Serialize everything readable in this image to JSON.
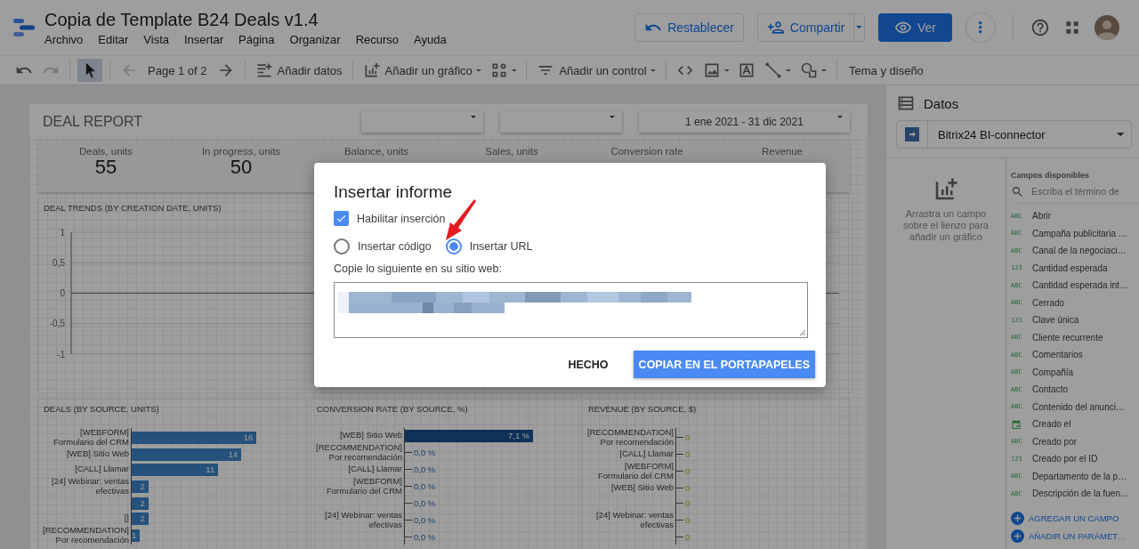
{
  "app": {
    "title": "Copia de Template B24 Deals v1.4",
    "menu": [
      "Archivo",
      "Editar",
      "Vista",
      "Insertar",
      "Página",
      "Organizar",
      "Recurso",
      "Ayuda"
    ],
    "actions": [
      {
        "kind": "reset",
        "label": "Restablecer"
      },
      {
        "kind": "share",
        "label": "Compartir"
      },
      {
        "kind": "view",
        "label": "Ver"
      }
    ]
  },
  "toolbar": [
    {
      "kind": "undo",
      "disabled": false,
      "selected": false
    },
    {
      "kind": "redo",
      "disabled": true,
      "selected": false
    },
    {
      "kind": "select",
      "disabled": false,
      "selected": true,
      "divider_before": true
    },
    {
      "kind": "prev",
      "disabled": true,
      "selected": false,
      "divider_before": true
    },
    {
      "kind": "page",
      "label": "Page 1 of 2",
      "disabled": false,
      "selected": false
    },
    {
      "kind": "next",
      "disabled": false,
      "selected": false
    },
    {
      "kind": "data",
      "label": "Añadir datos",
      "disabled": false,
      "selected": false,
      "divider_before": true
    },
    {
      "kind": "chart",
      "label": "Añadir un gráfico",
      "caret": true,
      "disabled": false,
      "selected": false,
      "divider_before": true
    },
    {
      "kind": "component",
      "caret": true,
      "disabled": false,
      "selected": false
    },
    {
      "kind": "control",
      "label": "Añadir un control",
      "caret": true,
      "disabled": false,
      "selected": false,
      "divider_before": true
    },
    {
      "kind": "embed",
      "disabled": false,
      "selected": false,
      "divider_before": true
    },
    {
      "kind": "image",
      "caret": true,
      "disabled": false,
      "selected": false
    },
    {
      "kind": "textbox",
      "disabled": false,
      "selected": false
    },
    {
      "kind": "line",
      "caret": true,
      "disabled": false,
      "selected": false
    },
    {
      "kind": "shape",
      "caret": true,
      "disabled": false,
      "selected": false
    },
    {
      "kind": "theme",
      "label": "Tema y diseño",
      "disabled": false,
      "selected": false,
      "divider_before": true
    }
  ],
  "report": {
    "title": "DEAL REPORT",
    "filters": [
      {
        "kind": "empty"
      },
      {
        "kind": "empty"
      },
      {
        "kind": "date",
        "value": "1 ene 2021 - 31 dic 2021"
      }
    ],
    "kpis": [
      {
        "label": "Deals, units",
        "value": "55"
      },
      {
        "label": "In progress, units",
        "value": "50"
      },
      {
        "label": "Balance, units"
      },
      {
        "label": "Sales, units"
      },
      {
        "label": "Conversion rate"
      },
      {
        "label": "Revenue"
      }
    ],
    "trend": {
      "title": "DEAL TRENDS (BY CREATION DATE, UNITS)",
      "axis_labels": [
        "1",
        "0,5",
        "0",
        "-0,5",
        "-1"
      ]
    },
    "charts": [
      {
        "title": "DEALS (BY SOURCE, UNITS)",
        "rows": [
          {
            "label": "[WEBFORM] Formulario del CRM",
            "level": 0.75,
            "reading": "16"
          },
          {
            "label": "[WEB] Sitio Web",
            "level": 0.66,
            "reading": "14"
          },
          {
            "label": "[CALL] Llamar",
            "level": 0.52,
            "reading": "11"
          },
          {
            "label": "[24] Webinar: ventas efectivas",
            "level": 0.1,
            "reading": "2"
          },
          {
            "level": 0.1,
            "reading": "2"
          },
          {
            "label": "[]",
            "level": 0.1,
            "reading": "2"
          },
          {
            "label": "[RECOMMENDATION] Por recomendación",
            "level": 0.05,
            "reading": "1"
          }
        ]
      },
      {
        "title": "CONVERSION RATE (BY SOURCE, %)",
        "rows": [
          {
            "label": "[WEB] Sitio Web",
            "level": 0.78,
            "reading": "7,1 %"
          },
          {
            "label": "[RECOMMENDATION] Por recomendación",
            "level": 0,
            "reading": "0,0 %"
          },
          {
            "label": "[CALL] Llamar",
            "level": 0,
            "reading": "0,0 %"
          },
          {
            "label": "[WEBFORM] Formulario del CRM",
            "level": 0,
            "reading": "0,0 %"
          },
          {
            "level": 0,
            "reading": "0,0 %"
          },
          {
            "label": "[24] Webinar: ventas efectivas",
            "level": 0,
            "reading": "0,0 %"
          },
          {
            "level": 0,
            "reading": "0,0 %"
          }
        ]
      },
      {
        "title": "REVENUE (BY SOURCE, $)",
        "rows": [
          {
            "label": "[RECOMMENDATION] Por recomendación",
            "level": 0,
            "reading": "0"
          },
          {
            "label": "[CALL] Llamar",
            "level": 0,
            "reading": "0"
          },
          {
            "label": "[WEBFORM] Formulario del CRM",
            "level": 0,
            "reading": "0"
          },
          {
            "label": "[WEB] Sitio Web",
            "level": 0,
            "reading": "0"
          },
          {
            "level": 0,
            "reading": "0"
          },
          {
            "label": "[24] Webinar: ventas efectivas",
            "level": 0,
            "reading": "0"
          },
          {
            "level": 0,
            "reading": "0"
          }
        ]
      }
    ]
  },
  "data_panel": {
    "title": "Datos",
    "source": "Bitrix24 BI-connector",
    "hint": "Arrastra un campo sobre el lienzo para añadir un gráfico",
    "fields_heading": "Campos disponibles",
    "search_placeholder": "Escriba el término de",
    "fields": [
      {
        "kind": "text",
        "type_label": "ABC",
        "name": "Abrir"
      },
      {
        "kind": "text",
        "type_label": "ABC",
        "name": "Campaña publicitaria …"
      },
      {
        "kind": "text",
        "type_label": "ABC",
        "name": "Canal de la negociaci…"
      },
      {
        "kind": "number",
        "type_label": "123",
        "name": "Cantidad esperada"
      },
      {
        "kind": "text",
        "type_label": "ABC",
        "name": "Cantidad esperada int…"
      },
      {
        "kind": "text",
        "type_label": "ABC",
        "name": "Cerrado"
      },
      {
        "kind": "number",
        "type_label": "123",
        "name": "Clave única"
      },
      {
        "kind": "text",
        "type_label": "ABC",
        "name": "Cliente recurrente"
      },
      {
        "kind": "text",
        "type_label": "ABC",
        "name": "Comentarios"
      },
      {
        "kind": "text",
        "type_label": "ABC",
        "name": "Compañía"
      },
      {
        "kind": "text",
        "type_label": "ABC",
        "name": "Contacto"
      },
      {
        "kind": "text",
        "type_label": "ABC",
        "name": "Contenido del anunci…"
      },
      {
        "kind": "date",
        "name": "Creado el"
      },
      {
        "kind": "text",
        "type_label": "ABC",
        "name": "Creado por"
      },
      {
        "kind": "number",
        "type_label": "123",
        "name": "Creado por el ID"
      },
      {
        "kind": "text",
        "type_label": "ABC",
        "name": "Departamento de la p…"
      },
      {
        "kind": "text",
        "type_label": "ABC",
        "name": "Descripción de la fuen…"
      }
    ],
    "buttons": [
      "AGREGAR UN CAMPO",
      "AÑADIR UN PARÁMET…"
    ]
  },
  "dialog": {
    "title": "Insertar informe",
    "enable": {
      "label": "Habilitar inserción",
      "checked": true
    },
    "options": [
      {
        "label": "Insertar código",
        "selected": false
      },
      {
        "label": "Insertar URL",
        "selected": true
      }
    ],
    "prompt": "Copie lo siguiente en su sitio web:",
    "buttons": [
      {
        "kind": "text",
        "label": "HECHO"
      },
      {
        "kind": "primary",
        "label": "COPIAR EN EL PORTAPAPELES"
      }
    ],
    "annotation": {
      "kind": "arrow"
    }
  }
}
